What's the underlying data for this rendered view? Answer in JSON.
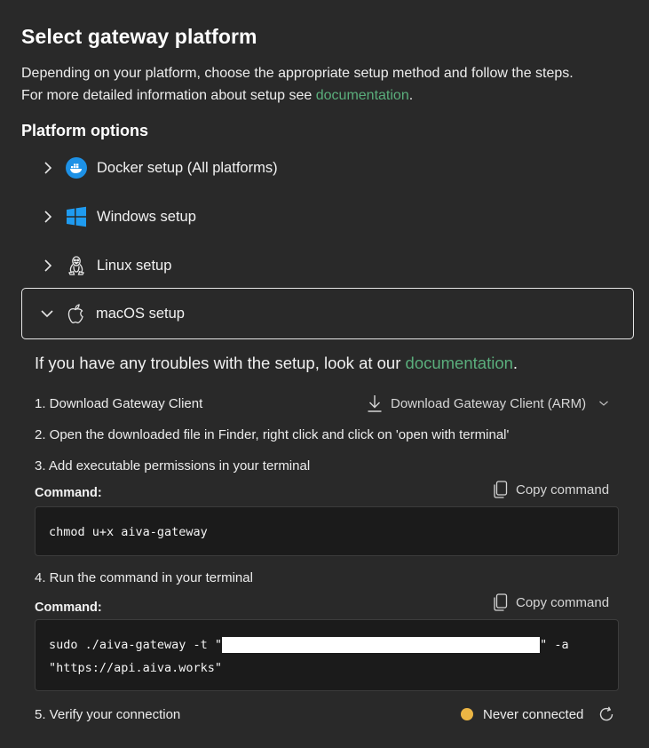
{
  "title": "Select gateway platform",
  "description": {
    "line1": "Depending on your platform, choose the appropriate setup method and follow the steps.",
    "line2_prefix": "For more detailed information about setup see ",
    "line2_link": "documentation",
    "line2_suffix": "."
  },
  "platform_options": {
    "heading": "Platform options",
    "items": [
      {
        "label": "Docker setup (All platforms)",
        "icon": "docker-icon",
        "expanded": false
      },
      {
        "label": "Windows setup",
        "icon": "windows-icon",
        "expanded": false
      },
      {
        "label": "Linux setup",
        "icon": "linux-icon",
        "expanded": false
      },
      {
        "label": "macOS setup",
        "icon": "apple-icon",
        "expanded": true
      }
    ]
  },
  "macos": {
    "intro_prefix": "If you have any troubles with the setup, look at our ",
    "intro_link": "documentation",
    "intro_suffix": ".",
    "step1": "1. Download Gateway Client",
    "download_label": "Download Gateway Client (ARM)",
    "step2": "2. Open the downloaded file in Finder, right click and click on 'open with terminal'",
    "step3": "3. Add executable permissions in your terminal",
    "command_label": "Command:",
    "copy_label": "Copy command",
    "cmd1": "chmod u+x aiva-gateway",
    "step4": "4. Run the command in your terminal",
    "cmd2_prefix": "sudo ./aiva-gateway -t \"",
    "cmd2_suffix": "\" -a",
    "cmd2_line2": "\"https://api.aiva.works\"",
    "step5": "5. Verify your connection",
    "status": "Never connected"
  },
  "colors": {
    "background": "#292929",
    "link": "#5aae7c",
    "status_dot": "#ebb544",
    "docker_blue": "#1d91e6",
    "windows_blue": "#1f9bf0"
  }
}
